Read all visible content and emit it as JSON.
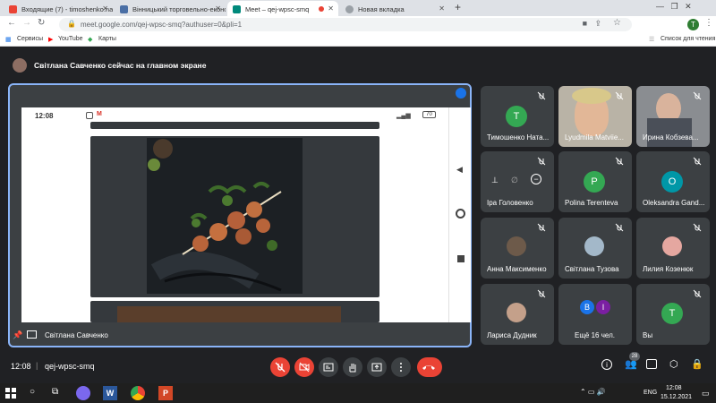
{
  "browser": {
    "tabs": [
      {
        "label": "Входящие (7) - timoshenko.nata"
      },
      {
        "label": "Вінницький торговельно-еконс"
      },
      {
        "label": "Meet – qej-wpsc-smq"
      },
      {
        "label": "Новая вкладка"
      }
    ],
    "url": "meet.google.com/qej-wpsc-smq?authuser=0&pli=1",
    "profile_initial": "T",
    "bookmarks": [
      "Сервисы",
      "YouTube",
      "Карты"
    ],
    "reading_list": "Список для чтения"
  },
  "meet": {
    "banner": "Світлана Савченко сейчас на главном экране",
    "presenter_name": "Світлана Савченко",
    "phone_time": "12:08",
    "phone_battery": "70",
    "participants": [
      {
        "name": "Тимошенко Ната...",
        "initial": "T",
        "color": "#34a853"
      },
      {
        "name": "Lyudmila Matviie..."
      },
      {
        "name": "Ирина Кобзева..."
      },
      {
        "name": "Іра Головенко"
      },
      {
        "name": "Polina Terenteva",
        "initial": "P",
        "color": "#34a853"
      },
      {
        "name": "Oleksandra Gand...",
        "initial": "O",
        "color": "#0097a7"
      },
      {
        "name": "Анна Максименко"
      },
      {
        "name": "Світлана Тузова"
      },
      {
        "name": "Лилия Козенюк"
      },
      {
        "name": "Лариса Дудник"
      },
      {
        "name": "Ещё 16 чел.",
        "initials": [
          "B",
          "I"
        ]
      },
      {
        "name": "Вы",
        "initial": "T",
        "color": "#34a853"
      }
    ],
    "bottom_time": "12:08",
    "meeting_code": "qej-wpsc-smq",
    "participant_count": "28"
  },
  "taskbar": {
    "lang": "ENG",
    "time": "12:08",
    "date": "15.12.2021"
  },
  "colors": {
    "meet_bg": "#202124",
    "tile_bg": "#3c4043",
    "end_call": "#ea4335",
    "accent": "#8ab4f8"
  }
}
